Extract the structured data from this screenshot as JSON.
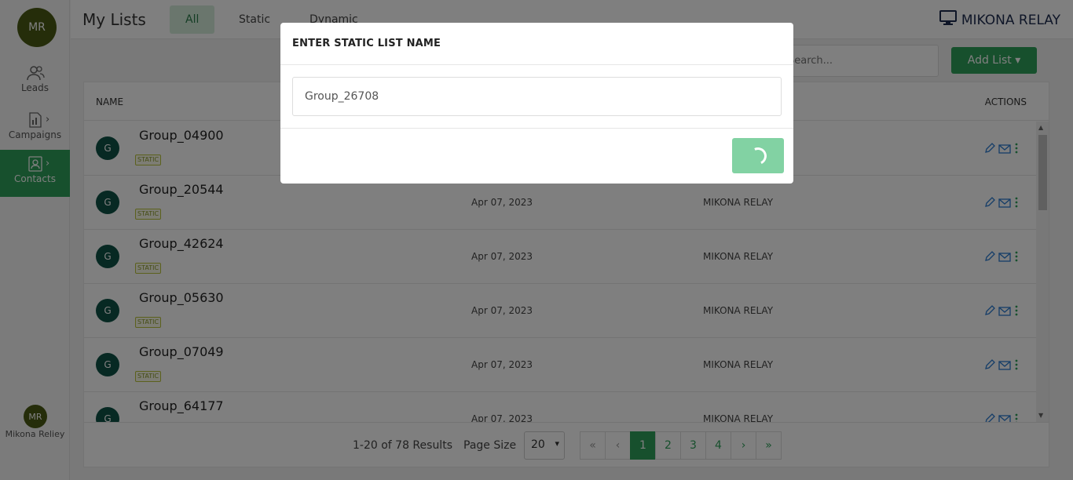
{
  "sidebar": {
    "avatar_initials": "MR",
    "items": [
      {
        "label": "Leads"
      },
      {
        "label": "Campaigns"
      },
      {
        "label": "Contacts"
      }
    ],
    "user_initials": "MR",
    "user_name": "Mikona Reliey"
  },
  "header": {
    "title": "My Lists",
    "tabs": [
      {
        "label": "All"
      },
      {
        "label": "Static"
      },
      {
        "label": "Dynamic"
      }
    ],
    "brand": "MIKONA RELAY"
  },
  "toolbar": {
    "search_placeholder": "Search...",
    "add_list_label": "Add List ▾"
  },
  "table": {
    "columns": {
      "name": "NAME",
      "actions": "ACTIONS"
    },
    "rows": [
      {
        "initial": "G",
        "name": "Group_04900",
        "badge": "STATIC",
        "date": "",
        "owner": ""
      },
      {
        "initial": "G",
        "name": "Group_20544",
        "badge": "STATIC",
        "date": "Apr 07, 2023",
        "owner": "MIKONA RELAY"
      },
      {
        "initial": "G",
        "name": "Group_42624",
        "badge": "STATIC",
        "date": "Apr 07, 2023",
        "owner": "MIKONA RELAY"
      },
      {
        "initial": "G",
        "name": "Group_05630",
        "badge": "STATIC",
        "date": "Apr 07, 2023",
        "owner": "MIKONA RELAY"
      },
      {
        "initial": "G",
        "name": "Group_07049",
        "badge": "STATIC",
        "date": "Apr 07, 2023",
        "owner": "MIKONA RELAY"
      },
      {
        "initial": "G",
        "name": "Group_64177",
        "badge": "",
        "date": "Apr 07, 2023",
        "owner": "MIKONA RELAY"
      }
    ]
  },
  "pagination": {
    "results": "1-20 of 78 Results",
    "page_size_label": "Page Size",
    "page_size": "20",
    "pages": [
      "«",
      "‹",
      "1",
      "2",
      "3",
      "4",
      "›",
      "»"
    ]
  },
  "modal": {
    "title": "ENTER STATIC LIST NAME",
    "input_value": "Group_26708"
  },
  "colors": {
    "accent": "#2ea05a",
    "avatar": "#0f5246",
    "badge": "#b8c23a"
  }
}
